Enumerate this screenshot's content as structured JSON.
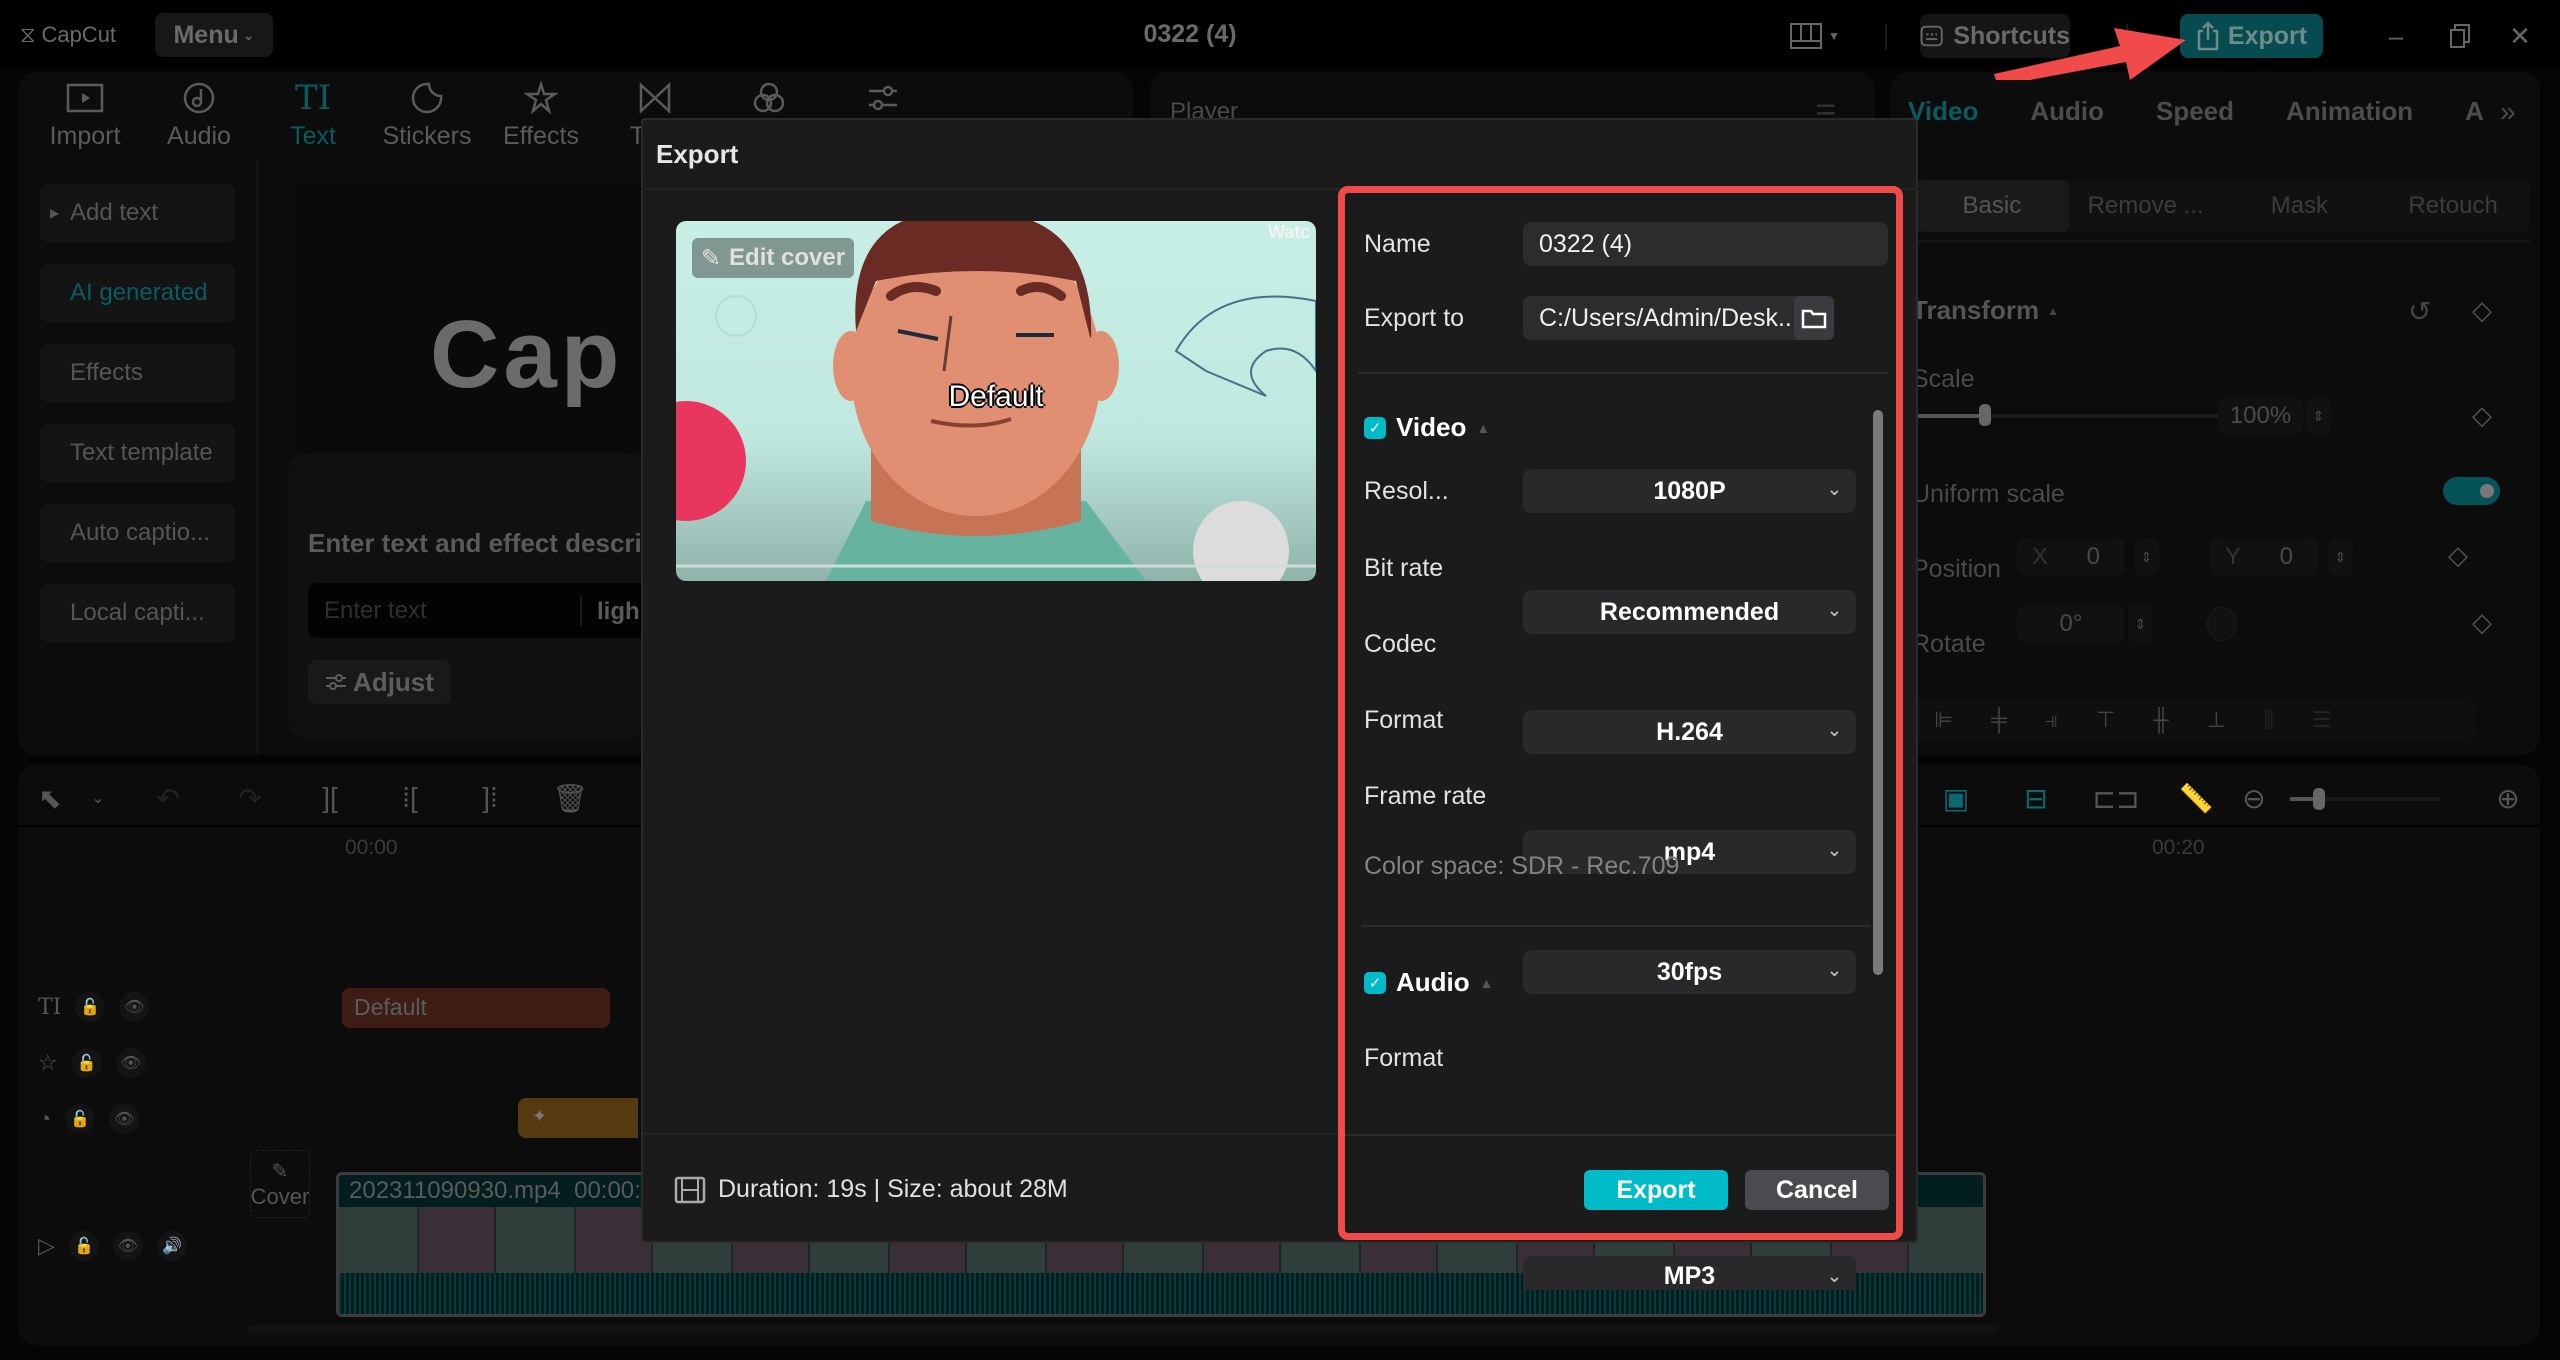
{
  "app": {
    "logo_text": "CapCut",
    "menu_label": "Menu",
    "document_title": "0322 (4)",
    "shortcuts_label": "Shortcuts",
    "export_label": "Export"
  },
  "toolbar": {
    "tools": [
      {
        "label": "Import",
        "icon": "import-icon"
      },
      {
        "label": "Audio",
        "icon": "audio-icon"
      },
      {
        "label": "Text",
        "icon": "text-icon",
        "active": true
      },
      {
        "label": "Stickers",
        "icon": "sticker-icon"
      },
      {
        "label": "Effects",
        "icon": "effects-icon"
      },
      {
        "label": "Tran",
        "icon": "transitions-icon"
      },
      {
        "label": "",
        "icon": "filters-icon"
      },
      {
        "label": "",
        "icon": "adjustment-icon"
      }
    ]
  },
  "text_panel": {
    "sidebar": [
      {
        "label": "Add text",
        "expandable": true
      },
      {
        "label": "AI generated",
        "active": true
      },
      {
        "label": "Effects"
      },
      {
        "label": "Text template"
      },
      {
        "label": "Auto captio..."
      },
      {
        "label": "Local capti..."
      }
    ],
    "preview_word": "Cap",
    "ai_prompt_title": "Enter text and effect descrip",
    "ai_input_placeholder": "Enter text",
    "ai_style_value": "ligh",
    "adjust_label": "Adjust"
  },
  "player": {
    "label": "Player"
  },
  "properties": {
    "tabs": [
      "Video",
      "Audio",
      "Speed",
      "Animation",
      "A"
    ],
    "active_tab": "Video",
    "subtabs": [
      "Basic",
      "Remove ...",
      "Mask",
      "Retouch"
    ],
    "active_subtab": "Basic",
    "transform_label": "Transform",
    "scale_label": "Scale",
    "scale_value": "100%",
    "scale_fraction": 0.2,
    "uniform_scale_label": "Uniform scale",
    "uniform_scale_on": true,
    "position_label": "Position",
    "position_x_label": "X",
    "position_x": "0",
    "position_y_label": "Y",
    "position_y": "0",
    "rotate_label": "Rotate",
    "rotate_value": "0°"
  },
  "timeline": {
    "ruler_start": "00:00",
    "ruler_mark": "00:20",
    "text_clip_label": "Default",
    "cover_label": "Cover",
    "video_clip_name": "202311090930.mp4",
    "video_clip_time": "00:00:"
  },
  "export_dialog": {
    "title": "Export",
    "edit_cover_label": "Edit cover",
    "cover_caption": "Default",
    "cover_watermark": "Watc",
    "name_label": "Name",
    "name_value": "0322 (4)",
    "export_to_label": "Export to",
    "export_to_value": "C:/Users/Admin/Desk...",
    "video_section": {
      "label": "Video",
      "checked": true,
      "rows": [
        {
          "label": "Resol...",
          "value": "1080P"
        },
        {
          "label": "Bit rate",
          "value": "Recommended"
        },
        {
          "label": "Codec",
          "value": "H.264"
        },
        {
          "label": "Format",
          "value": "mp4"
        },
        {
          "label": "Frame rate",
          "value": "30fps"
        }
      ],
      "color_space": "Color space: SDR - Rec.709"
    },
    "audio_section": {
      "label": "Audio",
      "checked": true,
      "rows": [
        {
          "label": "Format",
          "value": "MP3"
        }
      ]
    },
    "footer_info": "Duration: 19s | Size: about 28M",
    "export_button": "Export",
    "cancel_button": "Cancel"
  },
  "colors": {
    "accent": "#00bcc9",
    "highlight": "#f04a4a",
    "background": "#000000",
    "dialog_bg": "#1b1b1c"
  }
}
